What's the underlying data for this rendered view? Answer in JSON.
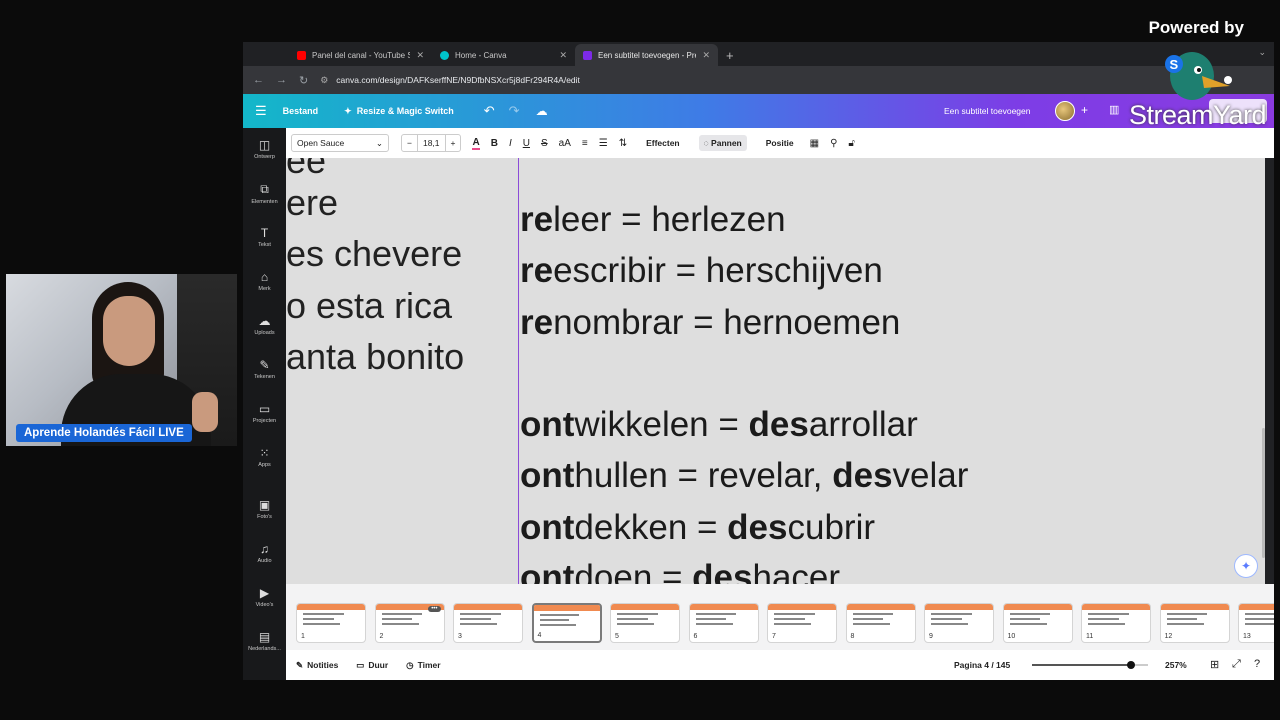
{
  "overlay": {
    "powered_by": "Powered by",
    "brand": "StreamYard"
  },
  "webcam": {
    "name_tag": "Aprende Holandés Fácil LIVE"
  },
  "browser": {
    "tabs": [
      {
        "title": "Panel del canal - YouTube St",
        "favicon_color": "#ff0000",
        "active": false
      },
      {
        "title": "Home - Canva",
        "favicon_color": "#00c4cc",
        "active": false
      },
      {
        "title": "Een subtitel toevoegen - Pre",
        "favicon_color": "#7d2ae8",
        "active": true
      }
    ],
    "new_tab": "+",
    "url": "canva.com/design/DAFKserffNE/N9DfbNSXcr5j8dFr294R4A/edit"
  },
  "canva": {
    "menu_label": "Bestand",
    "magic_label": "Resize & Magic Switch",
    "doc_title": "Een subtitel toevoegen",
    "sidebar": [
      {
        "label": "Ontwerp",
        "icon": "layout-icon"
      },
      {
        "label": "Elementen",
        "icon": "shapes-icon"
      },
      {
        "label": "Tekst",
        "icon": "text-icon"
      },
      {
        "label": "Merk",
        "icon": "brand-icon"
      },
      {
        "label": "Uploads",
        "icon": "upload-icon"
      },
      {
        "label": "Tekenen",
        "icon": "draw-icon"
      },
      {
        "label": "Projecten",
        "icon": "folder-icon"
      },
      {
        "label": "Apps",
        "icon": "apps-icon"
      },
      {
        "label": "Foto's",
        "icon": "photo-icon"
      },
      {
        "label": "Audio",
        "icon": "audio-icon"
      },
      {
        "label": "Video's",
        "icon": "video-icon"
      },
      {
        "label": "Nederlands...",
        "icon": "folder-thumb-icon"
      }
    ],
    "toolbar": {
      "font": "Open Sauce",
      "font_size": "18,1",
      "minus": "−",
      "plus": "+",
      "effects": "Effecten",
      "pan": "Pannen",
      "position": "Positie"
    },
    "left_column": [
      "ee",
      "ere",
      "es chevere",
      "o esta rica",
      "anta bonito"
    ],
    "right_column": [
      {
        "bold": "re",
        "rest": "leer = herlezen"
      },
      {
        "bold": "re",
        "rest": "escribir = herschijven"
      },
      {
        "bold": "re",
        "rest": "nombrar = hernoemen"
      },
      {
        "bold": "",
        "rest": ""
      },
      {
        "bold": "ont",
        "rest": "wikkelen = ",
        "bold2": "des",
        "rest2": "arrollar"
      },
      {
        "bold": "ont",
        "rest": "hullen = revelar, ",
        "bold2": "des",
        "rest2": "velar"
      },
      {
        "bold": "ont",
        "rest": "dekken = ",
        "bold2": "des",
        "rest2": "cubrir"
      },
      {
        "bold": "ont",
        "rest": "doen = ",
        "bold2": "des",
        "rest2": "hacer"
      }
    ],
    "thumbnails": [
      "1",
      "2",
      "3",
      "4",
      "5",
      "6",
      "7",
      "8",
      "9",
      "10",
      "11",
      "12",
      "13"
    ],
    "selected_page": 4,
    "footer": {
      "notes": "Notities",
      "duration": "Duur",
      "timer": "Timer",
      "page_indicator": "Pagina 4 / 145",
      "zoom": "257%",
      "zoom_level": 0.85
    }
  }
}
